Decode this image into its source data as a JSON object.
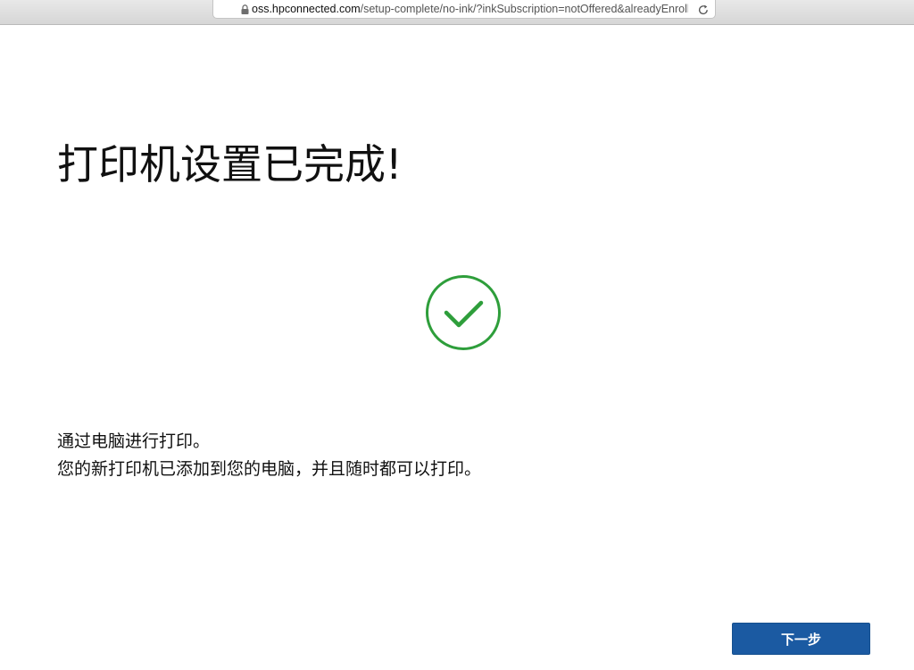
{
  "browser": {
    "url_domain": "oss.hpconnected.com",
    "url_path": "/setup-complete/no-ink/?inkSubscription=notOffered&alreadyEnrolled",
    "lock_icon": "lock-icon",
    "reload_icon": "reload-icon"
  },
  "main": {
    "title": "打印机设置已完成!",
    "status_icon": "check-circle-icon",
    "message_line1": "通过电脑进行打印。",
    "message_line2": "您的新打印机已添加到您的电脑，并且随时都可以打印。",
    "next_label": "下一步"
  },
  "colors": {
    "check_green": "#2e9e3b",
    "button_blue": "#1b5aa2",
    "text": "#111111"
  }
}
